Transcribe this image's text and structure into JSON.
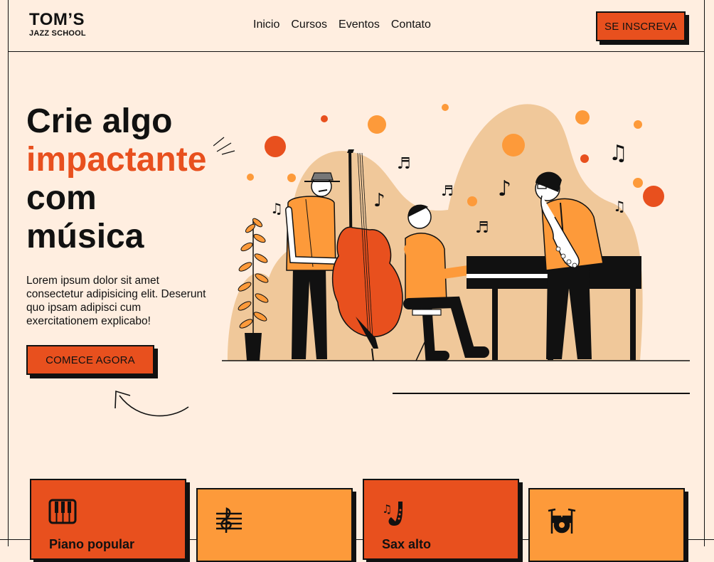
{
  "header": {
    "logo_main": "TOM’S",
    "logo_sub": "JAZZ SCHOOL",
    "nav": [
      "Inicio",
      "Cursos",
      "Eventos",
      "Contato"
    ],
    "signup_label": "SE INSCREVA"
  },
  "hero": {
    "title_line1": "Crie algo",
    "title_accent": "impactante",
    "title_line3": "com",
    "title_line4": "música",
    "description": "Lorem ipsum dolor sit amet consectetur adipisicing elit. Deserunt quo ipsam adipisci cum exercitationem explicabo!",
    "cta_label": "COMECE AGORA"
  },
  "courses": [
    {
      "title": "Piano popular",
      "icon": "piano-icon"
    },
    {
      "title": "",
      "icon": "music-staff-icon"
    },
    {
      "title": "Sax alto",
      "icon": "saxophone-icon"
    },
    {
      "title": "",
      "icon": "drums-icon"
    }
  ],
  "colors": {
    "background": "#ffeee0",
    "accent": "#e8501e",
    "light_orange": "#fd9a3a",
    "beige": "#f0c89a",
    "ink": "#111111"
  }
}
